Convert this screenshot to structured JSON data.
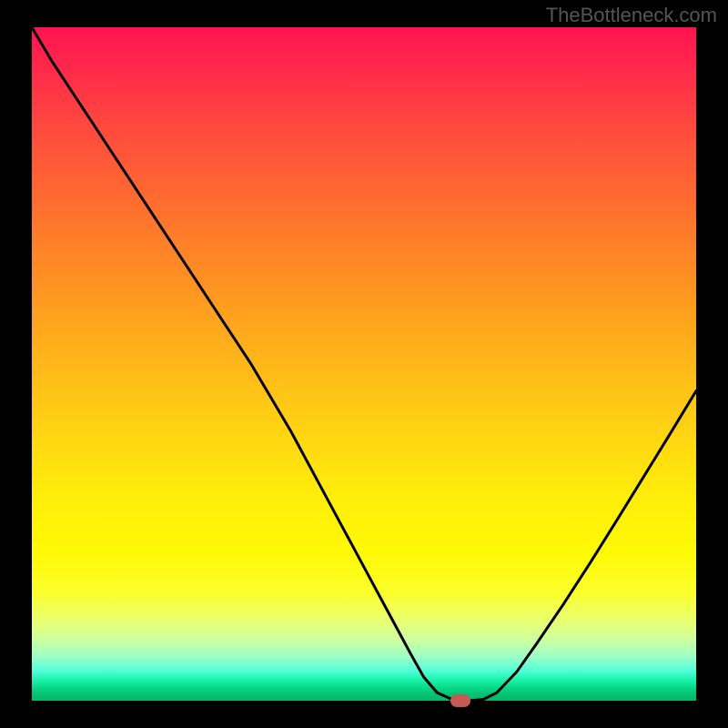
{
  "watermark": "TheBottleneck.com",
  "colors": {
    "frame": "#000000",
    "curve": "#000000",
    "marker": "#c45a54"
  },
  "chart_data": {
    "type": "line",
    "title": "",
    "xlabel": "",
    "ylabel": "",
    "xlim": [
      0,
      100
    ],
    "ylim": [
      0,
      100
    ],
    "x": [
      0,
      3,
      6,
      9,
      12,
      15,
      18,
      21,
      24,
      27,
      30,
      33,
      36,
      39,
      42,
      45,
      48,
      51,
      54,
      57,
      59,
      61,
      63,
      64.5,
      66,
      68,
      70,
      73,
      76,
      80,
      84,
      88,
      92,
      96,
      100
    ],
    "values": [
      100,
      95,
      90.5,
      86,
      81.5,
      77,
      72.5,
      68,
      63.5,
      59,
      54.5,
      50,
      45,
      40,
      34.5,
      29,
      23.5,
      18,
      12.5,
      7,
      3.5,
      1.2,
      0.3,
      0,
      0,
      0.2,
      1.2,
      4.3,
      8.5,
      14.3,
      20.4,
      26.7,
      33.1,
      39.5,
      46
    ],
    "marker": {
      "x": 64.5,
      "y": 0
    },
    "gradient_stops": [
      {
        "pos": 0.0,
        "hex": "#ff1351"
      },
      {
        "pos": 0.07,
        "hex": "#ff2c4a"
      },
      {
        "pos": 0.14,
        "hex": "#ff4640"
      },
      {
        "pos": 0.22,
        "hex": "#ff6034"
      },
      {
        "pos": 0.3,
        "hex": "#ff792b"
      },
      {
        "pos": 0.38,
        "hex": "#ff9222"
      },
      {
        "pos": 0.46,
        "hex": "#ffab1c"
      },
      {
        "pos": 0.54,
        "hex": "#ffc317"
      },
      {
        "pos": 0.62,
        "hex": "#ffd911"
      },
      {
        "pos": 0.7,
        "hex": "#ffee0b"
      },
      {
        "pos": 0.78,
        "hex": "#fff905"
      },
      {
        "pos": 0.84,
        "hex": "#fbff2c"
      },
      {
        "pos": 0.88,
        "hex": "#eaff6f"
      },
      {
        "pos": 0.91,
        "hex": "#cdffa0"
      },
      {
        "pos": 0.935,
        "hex": "#9bffc8"
      },
      {
        "pos": 0.955,
        "hex": "#55ffd9"
      },
      {
        "pos": 0.97,
        "hex": "#18f2a8"
      },
      {
        "pos": 0.982,
        "hex": "#08d584"
      },
      {
        "pos": 0.991,
        "hex": "#04c272"
      },
      {
        "pos": 1.0,
        "hex": "#02b969"
      }
    ]
  }
}
